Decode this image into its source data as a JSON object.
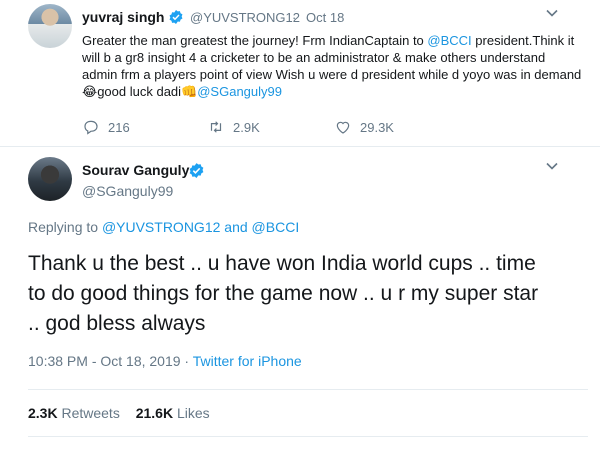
{
  "reply_tweet": {
    "author_name": "yuvraj singh",
    "author_handle": "@YUVSTRONG12",
    "separator": "·",
    "date": "Oct 18",
    "text_part1": "Greater the man greatest the journey! Frm IndianCaptain to ",
    "mention_bcci": "@BCCI",
    "text_part2": " president.Think it will b a gr8 insight 4 a cricketer to be an administrator & make others understand admin frm a players point of view Wish u were d president while d yoyo was in demand",
    "emoji_laugh": "😂",
    "text_part3": "good luck dadi",
    "emoji_fist": "👊",
    "mention_sg": "@SGanguly99",
    "replies": "216",
    "retweets": "2.9K",
    "likes": "29.3K"
  },
  "main_tweet": {
    "author_name": "Sourav Ganguly",
    "author_handle": "@SGanguly99",
    "replying_prefix": "Replying to ",
    "replying_mention1": "@YUVSTRONG12",
    "replying_and": " and ",
    "replying_mention2": "@BCCI",
    "text_line1": "Thank u the best .. u have won India world cups .. time",
    "text_line2": "to do good things for the game now .. u r my super star",
    "text_line3": ".. god bless always",
    "timestamp": "10:38 PM - Oct 18, 2019",
    "meta_sep": " · ",
    "source": "Twitter for iPhone",
    "retweet_count": "2.3K",
    "retweet_label": " Retweets",
    "like_count": "21.6K",
    "like_label": " Likes"
  },
  "colors": {
    "link": "#1b95e0",
    "muted": "#657786",
    "verified": "#1da1f2",
    "divider": "#e6ecf0"
  },
  "icons": [
    "verified-badge-icon",
    "chevron-down-icon",
    "reply-icon",
    "retweet-icon",
    "like-icon"
  ]
}
